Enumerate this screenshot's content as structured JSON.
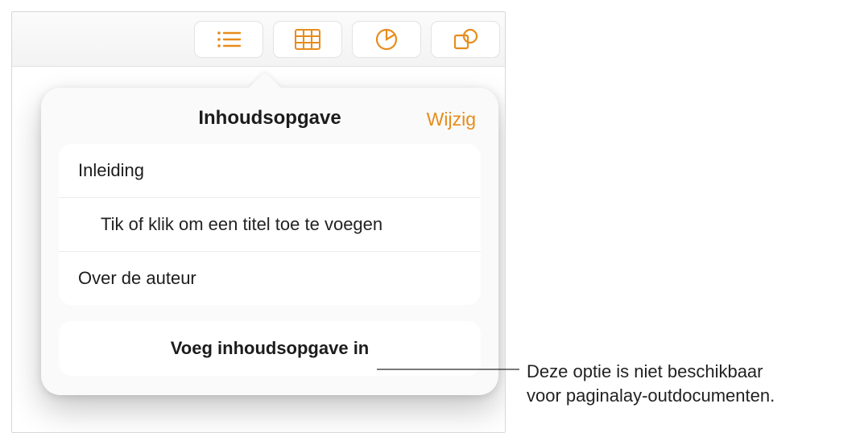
{
  "toolbar": {
    "buttons": [
      {
        "name": "toc-view-icon"
      },
      {
        "name": "table-icon"
      },
      {
        "name": "chart-icon"
      },
      {
        "name": "shape-icon"
      }
    ]
  },
  "popover": {
    "title": "Inhoudsopgave",
    "edit": "Wijzig",
    "items": [
      {
        "label": "Inleiding",
        "indent": false
      },
      {
        "label": "Tik of klik om een titel toe te voegen",
        "indent": true
      },
      {
        "label": "Over de auteur",
        "indent": false
      }
    ],
    "insert_button": "Voeg inhoudsopgave in"
  },
  "callout": {
    "line1": "Deze optie is niet beschikbaar",
    "line2": "voor paginalay-outdocumenten."
  }
}
